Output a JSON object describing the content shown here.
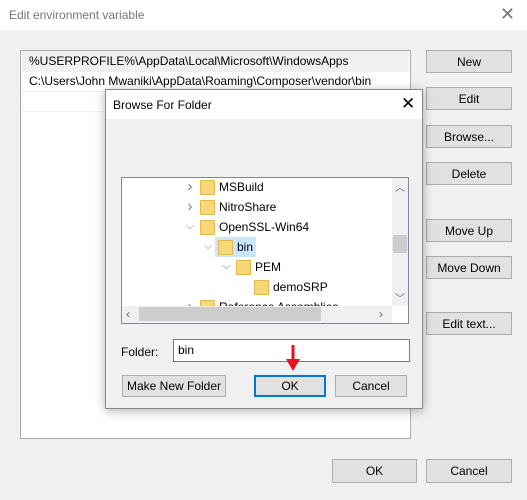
{
  "window": {
    "title": "Edit environment variable"
  },
  "paths": [
    "%USERPROFILE%\\AppData\\Local\\Microsoft\\WindowsApps",
    "C:\\Users\\John Mwaniki\\AppData\\Roaming\\Composer\\vendor\\bin"
  ],
  "buttons": {
    "new": "New",
    "edit": "Edit",
    "browse": "Browse...",
    "delete": "Delete",
    "move_up": "Move Up",
    "move_down": "Move Down",
    "edit_text": "Edit text...",
    "ok": "OK",
    "cancel": "Cancel"
  },
  "browse_dialog": {
    "title": "Browse For Folder",
    "tree": [
      {
        "label": "MSBuild",
        "level": 0,
        "expander": "collapsed"
      },
      {
        "label": "NitroShare",
        "level": 0,
        "expander": "collapsed"
      },
      {
        "label": "OpenSSL-Win64",
        "level": 0,
        "expander": "expanded"
      },
      {
        "label": "bin",
        "level": 1,
        "expander": "expanded",
        "selected": true
      },
      {
        "label": "PEM",
        "level": 2,
        "expander": "expanded"
      },
      {
        "label": "demoSRP",
        "level": 3,
        "expander": "none"
      },
      {
        "label": "Reference Assemblies",
        "level": 0,
        "expander": "collapsed"
      }
    ],
    "folder_label": "Folder:",
    "folder_value": "bin",
    "make_new_folder": "Make New Folder",
    "ok": "OK",
    "cancel": "Cancel"
  },
  "colors": {
    "selection": "#cce8ff",
    "accent": "#0078d7",
    "arrow": "#e81123"
  }
}
